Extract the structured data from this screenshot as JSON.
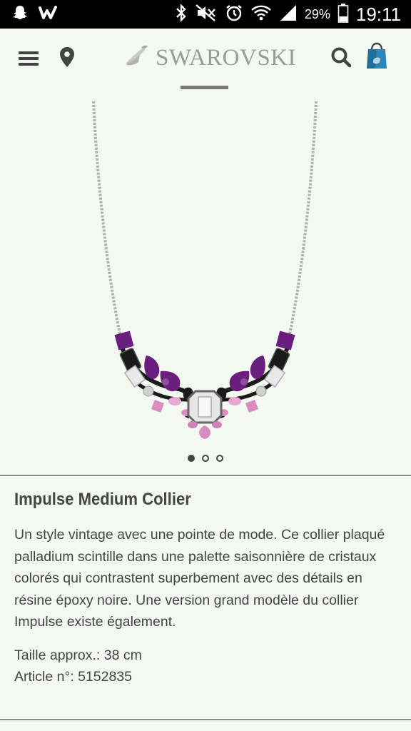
{
  "status_bar": {
    "battery": "29%",
    "time": "19:11",
    "left_icons": [
      "snapchat-icon",
      "wish-icon"
    ],
    "right_icons": [
      "bluetooth-icon",
      "mute-icon",
      "alarm-icon",
      "wifi-icon",
      "signal-icon",
      "battery-icon"
    ]
  },
  "header": {
    "brand": "SWAROVSKI",
    "icons": [
      "menu-icon",
      "location-icon",
      "search-icon",
      "shopping-bag-icon"
    ]
  },
  "carousel": {
    "image_alt": "Impulse Medium Collier",
    "slide_count": 3,
    "active_slide": 1
  },
  "product": {
    "title": "Impulse Medium Collier",
    "description": "Un style vintage avec une pointe de mode. Ce collier plaqué palladium scintille dans une palette saisonnière de cristaux colorés qui contrastent superbement avec des détails en résine époxy noire. Une version grand modèle du collier Impulse existe également.",
    "size_line": "Taille approx.: 38 cm",
    "article_line": "Article n°: 5152835"
  },
  "colors": {
    "background": "#f3f8f1",
    "purple": "#6a1f7e",
    "pink": "#d98cc0",
    "black": "#1a1a1a"
  }
}
